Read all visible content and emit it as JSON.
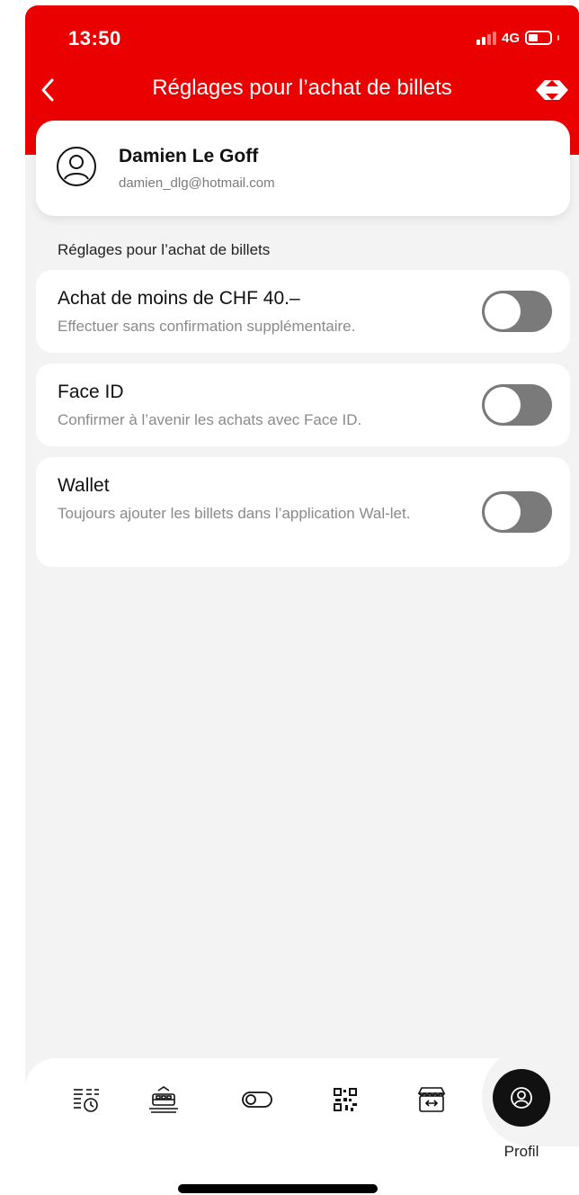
{
  "status_bar": {
    "time": "13:50",
    "network": "4G"
  },
  "header": {
    "title": "Réglages pour l’achat de billets",
    "brand_color": "#eb0000"
  },
  "profile": {
    "name": "Damien Le Goff",
    "email": "damien_dlg@hotmail.com",
    "icon": "user-circle-icon"
  },
  "section": {
    "label": "Réglages pour l’achat de billets"
  },
  "settings": [
    {
      "title": "Achat de moins de CHF 40.–",
      "description": "Effectuer sans confirmation supplémentaire.",
      "enabled": false
    },
    {
      "title": "Face ID",
      "description": "Confirmer à l’avenir les achats avec Face ID.",
      "enabled": false
    },
    {
      "title": "Wallet",
      "description": "Toujours ajouter les billets dans l’application Wal-let.",
      "enabled": false
    }
  ],
  "tabbar": {
    "items": [
      {
        "icon": "timetable-clock-icon"
      },
      {
        "icon": "train-station-icon"
      },
      {
        "icon": "toggle-icon"
      },
      {
        "icon": "qr-code-icon"
      },
      {
        "icon": "shop-icon"
      }
    ],
    "active": {
      "icon": "profile-icon",
      "label": "Profil"
    }
  }
}
